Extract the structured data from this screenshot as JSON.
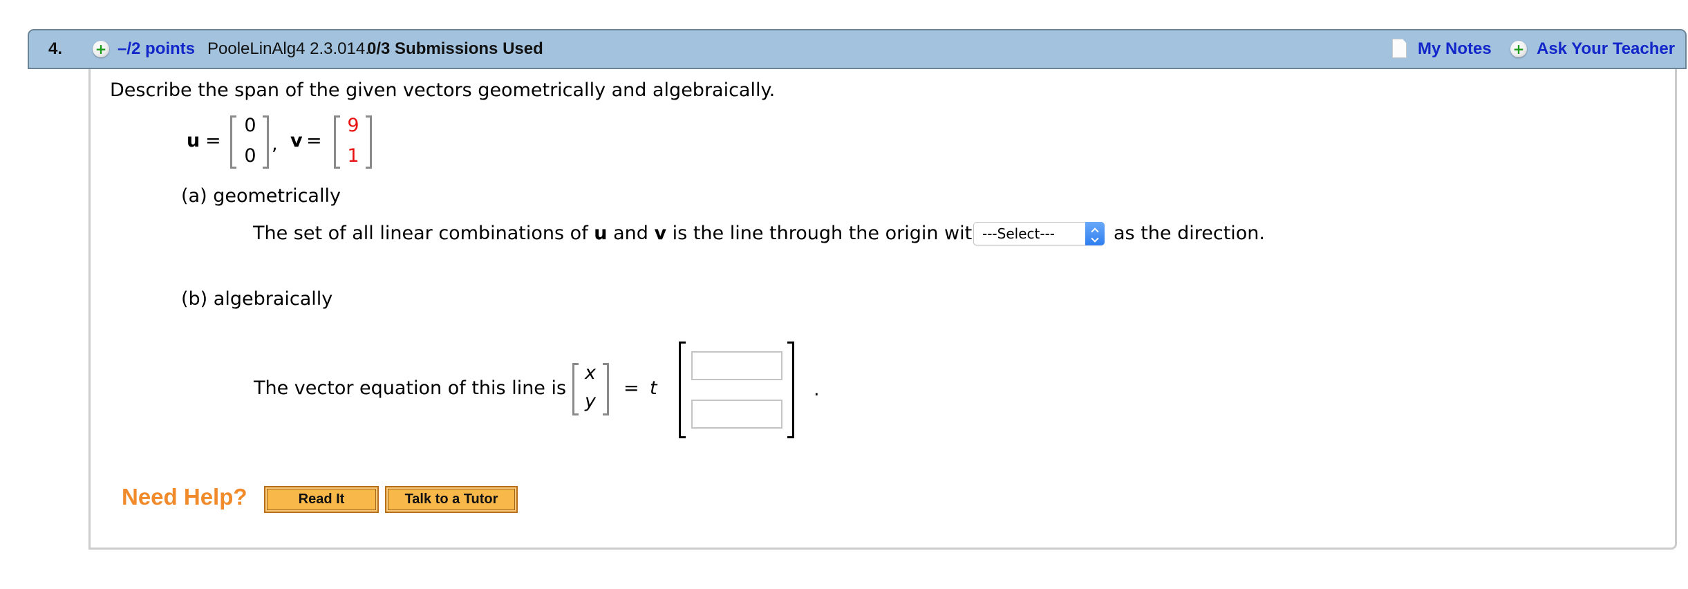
{
  "header": {
    "question_number": "4.",
    "points_label": "–/2 points",
    "source": "PooleLinAlg4 2.3.014.",
    "submissions": "0/3 Submissions Used",
    "my_notes": "My Notes",
    "ask_teacher": "Ask Your Teacher",
    "icons": {
      "points": "plus-circle-icon",
      "notes": "note-page-icon",
      "teacher": "plus-circle-icon"
    }
  },
  "question": {
    "prompt": "Describe the span of the given vectors geometrically and algebraically.",
    "u_label": "u",
    "v_label": "v",
    "equals": "=",
    "comma": ",",
    "u_values": [
      "0",
      "0"
    ],
    "v_values": [
      "9",
      "1"
    ]
  },
  "part_a": {
    "label": "(a) geometrically",
    "text_before": "The set of all linear combinations of ",
    "u": "u",
    "and": " and ",
    "v": "v",
    "text_after_v": " is the line through the origin with",
    "select_value": "---Select---",
    "text_after_select": "as the direction."
  },
  "part_b": {
    "label": "(b) algebraically",
    "text": "The vector equation of this line is",
    "x": "x",
    "y": "y",
    "equals": "=",
    "t": "t",
    "answer_values": [
      "",
      ""
    ],
    "period": "."
  },
  "help": {
    "need_help": "Need Help?",
    "read_it": "Read It",
    "talk_tutor": "Talk to a Tutor"
  },
  "colors": {
    "header_bg": "#a2c2de",
    "link_blue": "#1326c9",
    "given_value_red": "#e81010",
    "help_orange": "#f08a2a",
    "button_orange": "#f8b84a"
  }
}
